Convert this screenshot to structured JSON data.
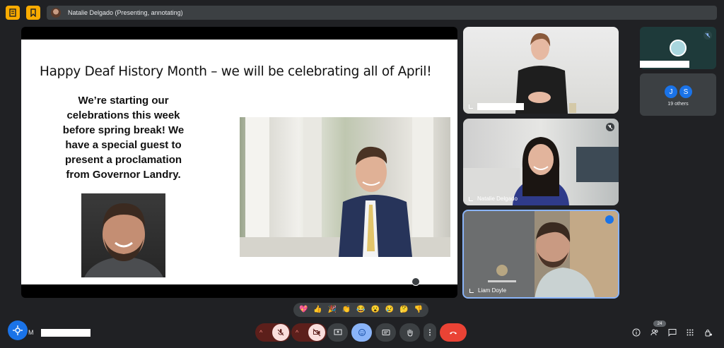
{
  "topbar": {
    "presenting_label": "Natalie Delgado (Presenting, annotating)"
  },
  "slide": {
    "title": "Happy Deaf History Month – we will be celebrating all of April!",
    "body_lines": [
      "We’re starting our",
      "celebrations this week",
      "before spring break! We",
      "have a special guest to",
      "present a proclamation",
      "from Governor Landry."
    ]
  },
  "tiles": {
    "natalie_name": "Natalie Delgado",
    "liam_name": "Liam Doyle"
  },
  "others": {
    "initials": [
      "J",
      "S"
    ],
    "label": "19 others"
  },
  "reactions": [
    "💖",
    "👍",
    "🎉",
    "👏",
    "😂",
    "😮",
    "😢",
    "🤔",
    "👎"
  ],
  "bottom": {
    "meeting_code_prefix": "M",
    "people_count": "24"
  },
  "colors": {
    "background": "#202124",
    "accent": "#1a73e8",
    "danger": "#ea4335",
    "muted_btn": "#f9dedc",
    "present_btn": "#f9ab00"
  }
}
